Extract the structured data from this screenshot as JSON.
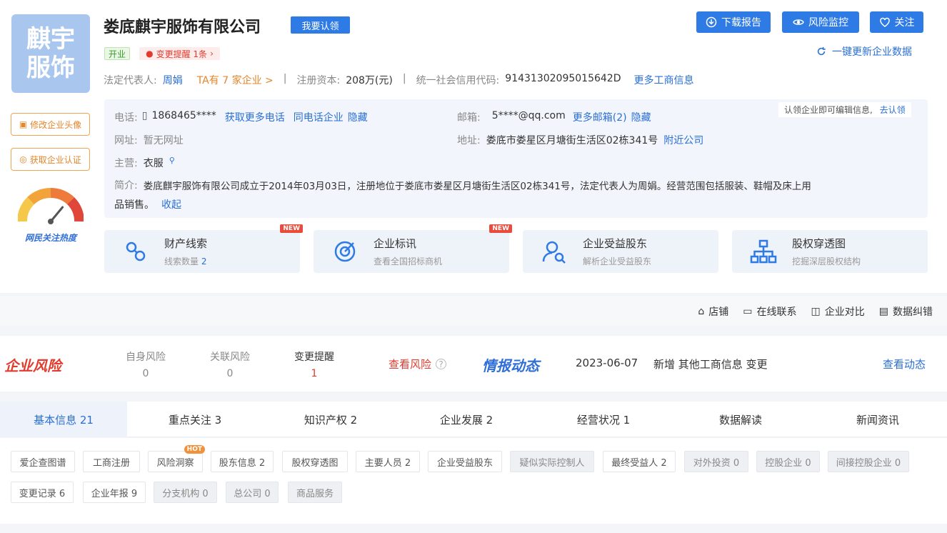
{
  "company": {
    "name": "娄底麒宇服饰有限公司",
    "logo_line1": "麒宇",
    "logo_line2": "服饰",
    "claim_label": "我要认领",
    "status_badge": "开业",
    "change_badge": "变更提醒 1条"
  },
  "header_buttons": {
    "download": "下载报告",
    "monitor": "风险监控",
    "follow": "关注",
    "refresh": "一键更新企业数据"
  },
  "summary_row": {
    "legal_rep_label": "法定代表人:",
    "legal_rep_name": "周娟",
    "ta_link": "TA有 7 家企业 >",
    "capital_label": "注册资本:",
    "capital_value": "208万(元)",
    "credit_code_label": "统一社会信用代码:",
    "credit_code_value": "91431302095015642D",
    "more_link": "更多工商信息"
  },
  "side_buttons": {
    "edit_avatar": "修改企业头像",
    "get_cert": "获取企业认证",
    "heat_label": "网民关注热度",
    "heat_level": 0.72
  },
  "contact": {
    "claim_tip": "认领企业即可编辑信息,",
    "claim_link": "去认领",
    "phone_label": "电话:",
    "phone_value": "1868465****",
    "phone_more": "获取更多电话",
    "phone_same": "同电话企业",
    "phone_hide": "隐藏",
    "email_label": "邮箱:",
    "email_value": "5****@qq.com",
    "email_more": "更多邮箱(2)",
    "email_hide": "隐藏",
    "website_label": "网址:",
    "website_value": "暂无网址",
    "address_label": "地址:",
    "address_value": "娄底市娄星区月塘街生活区02栋341号",
    "address_link": "附近公司",
    "business_label": "主营:",
    "business_value": "衣服",
    "intro_label": "简介:",
    "intro_text": "娄底麒宇服饰有限公司成立于2014年03月03日，注册地位于娄底市娄星区月塘街生活区02栋341号，法定代表人为周娟。经营范围包括服装、鞋帽及床上用",
    "intro_text2": "品销售。",
    "intro_collapse": "收起"
  },
  "features": [
    {
      "title": "财产线索",
      "sub": "线索数量",
      "count": "2",
      "new": "NEW"
    },
    {
      "title": "企业标讯",
      "sub": "查看全国招标商机",
      "count": "",
      "new": "NEW"
    },
    {
      "title": "企业受益股东",
      "sub": "解析企业受益股东",
      "count": "",
      "new": ""
    },
    {
      "title": "股权穿透图",
      "sub": "挖掘深层股权结构",
      "count": "",
      "new": ""
    }
  ],
  "toolbar": {
    "shop": "店铺",
    "contact_online": "在线联系",
    "compare": "企业对比",
    "data_fix": "数据纠错"
  },
  "risk": {
    "title": "企业风险",
    "self_label": "自身风险",
    "self_value": "0",
    "related_label": "关联风险",
    "related_value": "0",
    "change_label": "变更提醒",
    "change_value": "1",
    "view_link": "查看风险",
    "intel_title": "情报动态",
    "intel_date": "2023-06-07",
    "intel_text": "新增 其他工商信息 变更",
    "intel_link": "查看动态"
  },
  "tabs": [
    {
      "label": "基本信息 21"
    },
    {
      "label": "重点关注 3"
    },
    {
      "label": "知识产权 2"
    },
    {
      "label": "企业发展 2"
    },
    {
      "label": "经营状况 1"
    },
    {
      "label": "数据解读"
    },
    {
      "label": "新闻资讯"
    }
  ],
  "chips_row1": [
    {
      "label": "爱企查图谱"
    },
    {
      "label": "工商注册"
    },
    {
      "label": "风险洞察",
      "tag": "HOT"
    },
    {
      "label": "股东信息 2"
    },
    {
      "label": "股权穿透图"
    },
    {
      "label": "主要人员 2"
    },
    {
      "label": "企业受益股东"
    },
    {
      "label": "疑似实际控制人"
    },
    {
      "label": "最终受益人 2"
    },
    {
      "label": "对外投资 0"
    },
    {
      "label": "控股企业 0"
    },
    {
      "label": "间接控股企业 0"
    }
  ],
  "chips_row2": [
    {
      "label": "变更记录 6"
    },
    {
      "label": "企业年报 9"
    },
    {
      "label": "分支机构 0"
    },
    {
      "label": "总公司 0"
    },
    {
      "label": "商品服务"
    }
  ],
  "colors": {
    "primary": "#2f7be6",
    "risk_red": "#e23b2e",
    "orange": "#e4862a",
    "logo_bg": "#a9c7ee"
  }
}
